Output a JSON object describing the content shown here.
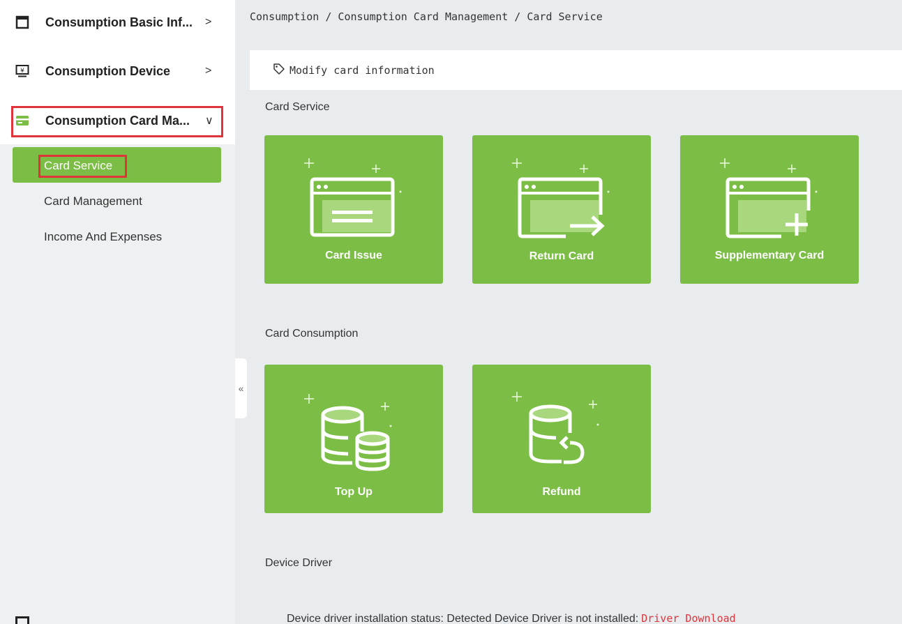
{
  "sidebar": {
    "menus": [
      {
        "label": "Consumption Basic Inf...",
        "icon": "window-icon",
        "arrow": ">"
      },
      {
        "label": "Consumption Device",
        "icon": "monitor-yuan-icon",
        "arrow": ">"
      },
      {
        "label": "Consumption Card Ma...",
        "icon": "card-icon",
        "arrow": "∨"
      }
    ],
    "sub_items": [
      "Card Service",
      "Card Management",
      "Income And Expenses"
    ],
    "collapse_label": "«"
  },
  "breadcrumb": "Consumption / Consumption Card Management / Card Service",
  "toolbar": {
    "modify_label": "Modify card information"
  },
  "sections": {
    "card_service": {
      "title": "Card Service",
      "tiles": [
        "Card Issue",
        "Return Card",
        "Supplementary Card"
      ]
    },
    "card_consumption": {
      "title": "Card Consumption",
      "tiles": [
        "Top Up",
        "Refund"
      ]
    },
    "device_driver": {
      "title": "Device Driver",
      "status_text": "Device driver installation status:  Detected Device Driver is not installed:",
      "link_text": "Driver Download"
    }
  },
  "colors": {
    "accent": "#7bbd45",
    "highlight": "#e0333a",
    "link": "#e0333a"
  }
}
